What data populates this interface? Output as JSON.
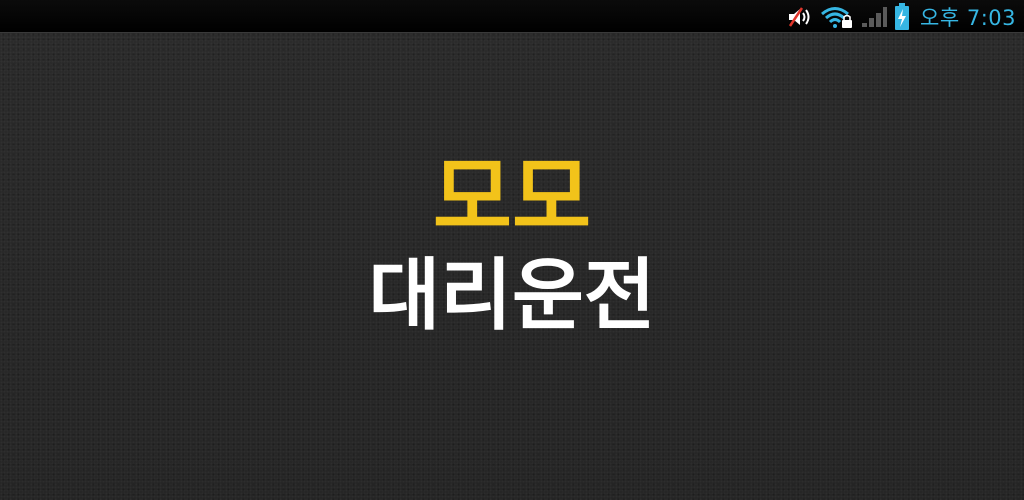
{
  "status_bar": {
    "time": "오후 7:03",
    "icons": [
      "volume-muted-icon",
      "wifi-locked-icon",
      "signal-icon",
      "battery-charging-icon"
    ],
    "accent_color": "#36b6e3"
  },
  "splash": {
    "brand": "모모",
    "service": "대리운전",
    "brand_color": "#f2c31a",
    "service_color": "#ffffff"
  }
}
